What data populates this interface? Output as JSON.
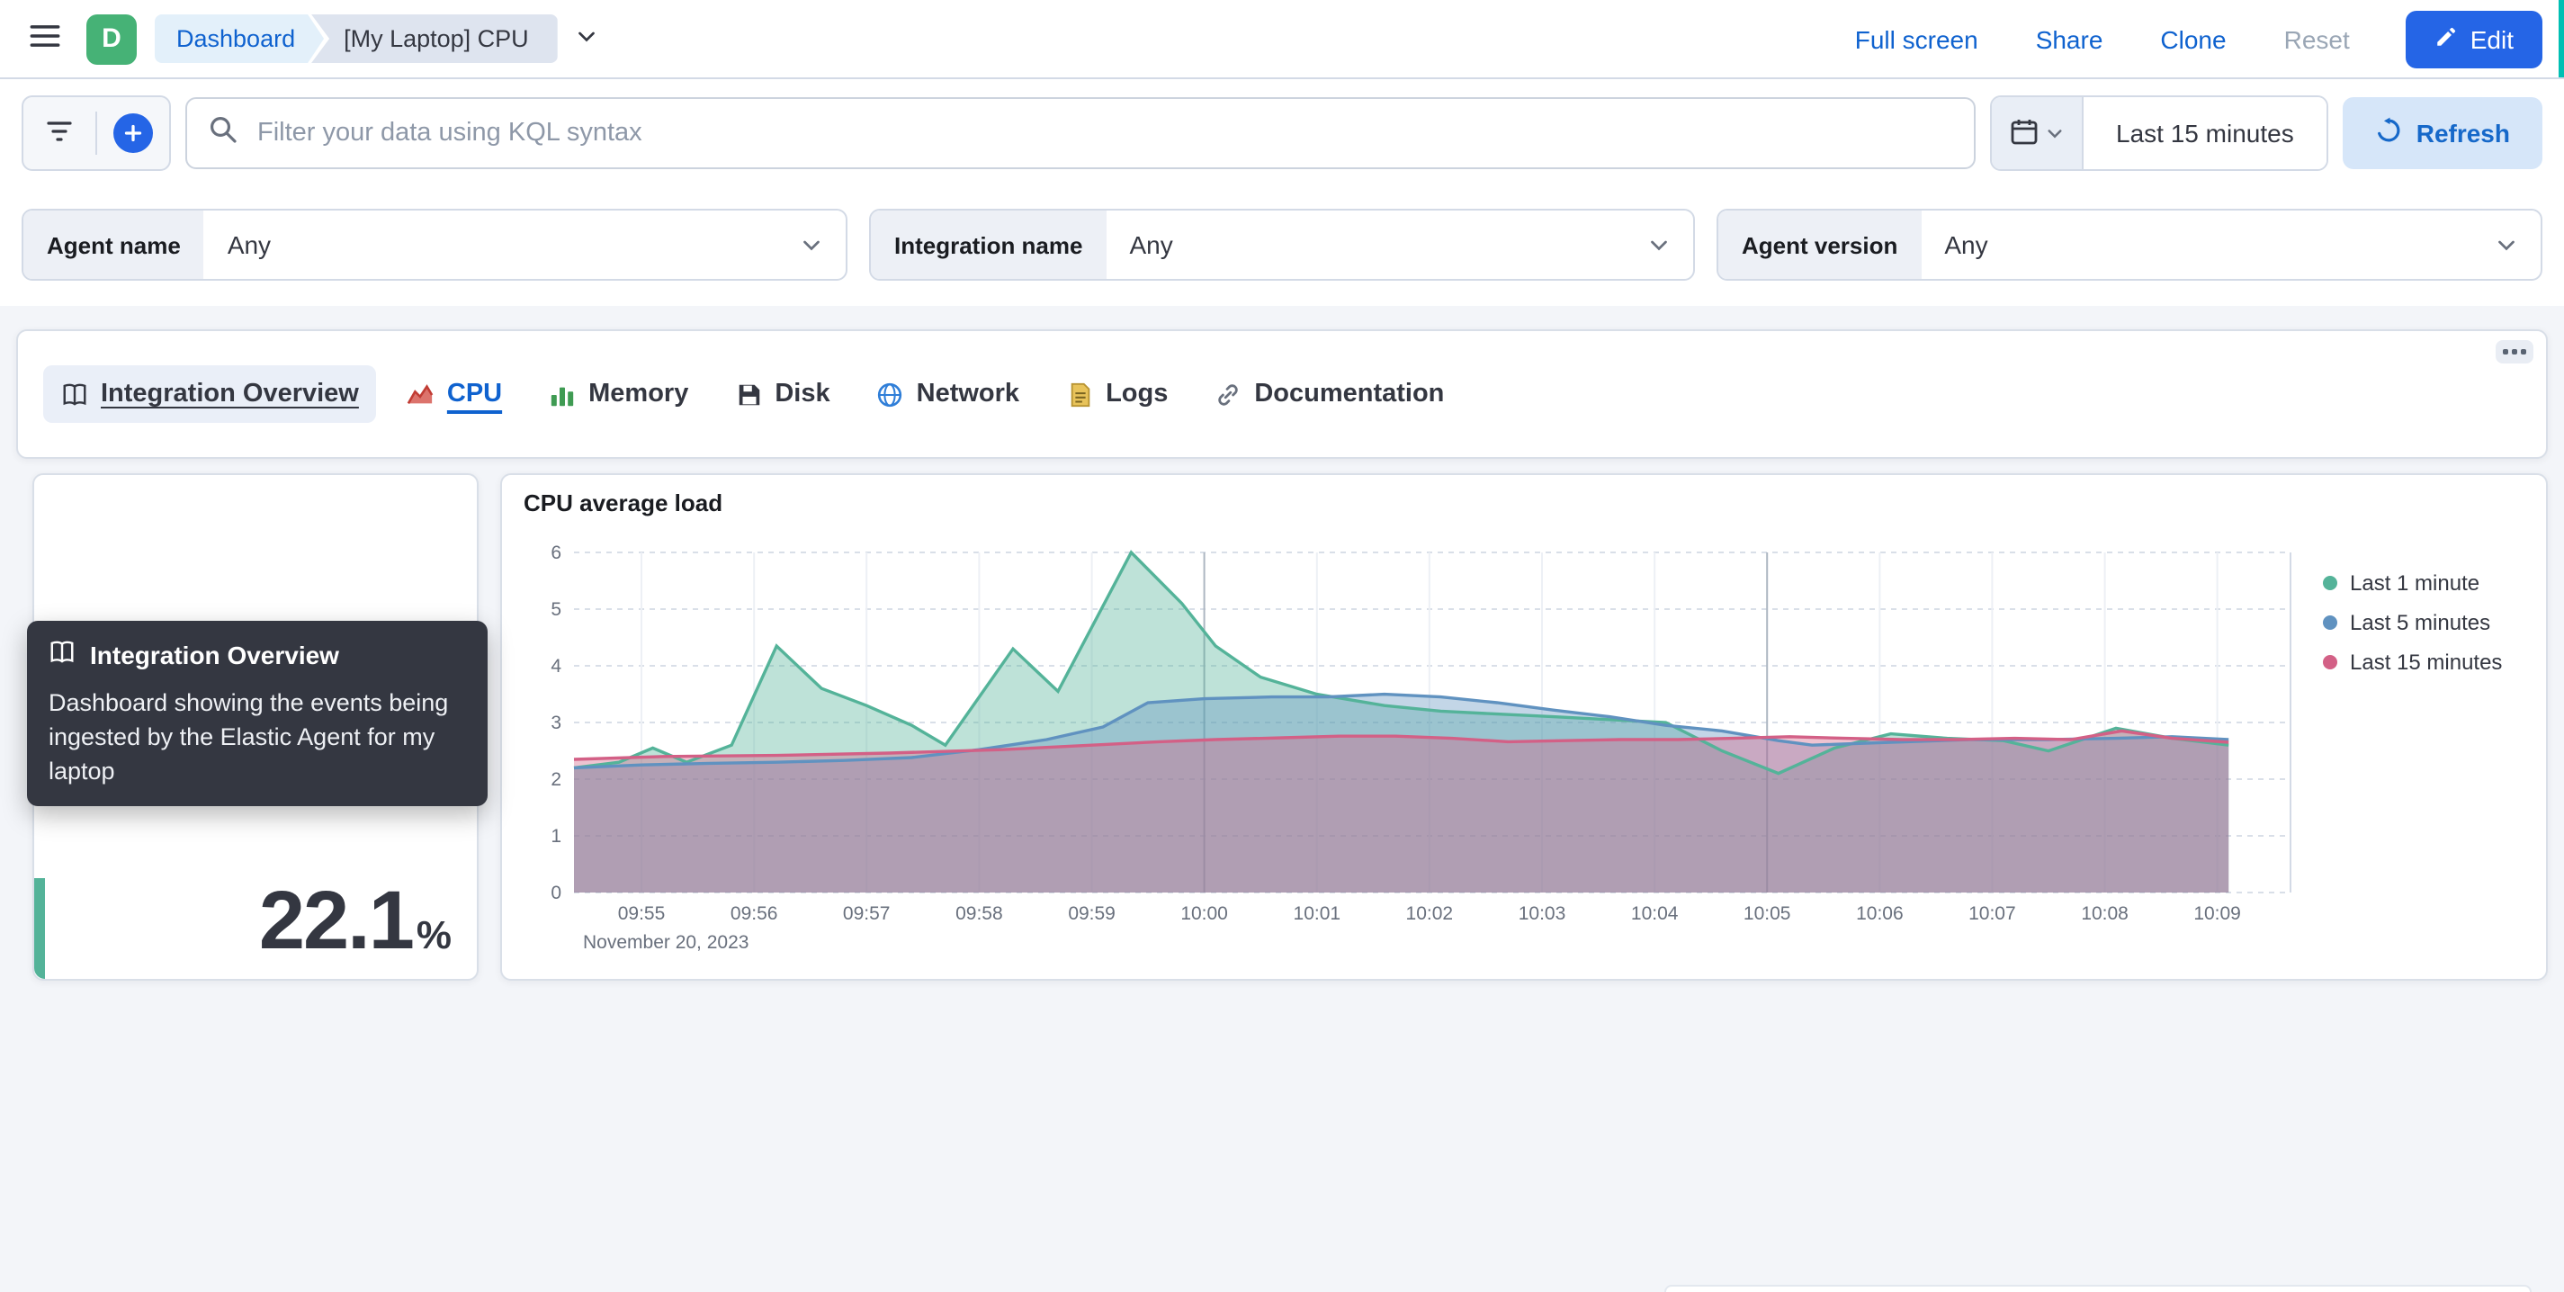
{
  "colors": {
    "primary_button": "#2565e6",
    "link": "#0f62cf",
    "logo_green": "#46b276",
    "metric_accent": "#54B399",
    "series_green": "#54B399",
    "series_blue": "#6092C0",
    "series_pink": "#D36086"
  },
  "header": {
    "logo_letter": "D",
    "breadcrumbs": [
      {
        "label": "Dashboard"
      },
      {
        "label": "[My Laptop] CPU"
      }
    ],
    "actions": [
      {
        "label": "Full screen",
        "enabled": true
      },
      {
        "label": "Share",
        "enabled": true
      },
      {
        "label": "Clone",
        "enabled": true
      },
      {
        "label": "Reset",
        "enabled": false
      }
    ],
    "edit_label": "Edit"
  },
  "query_bar": {
    "search_placeholder": "Filter your data using KQL syntax",
    "time_range": "Last 15 minutes",
    "refresh_label": "Refresh"
  },
  "filters": [
    {
      "label": "Agent name",
      "value": "Any"
    },
    {
      "label": "Integration name",
      "value": "Any"
    },
    {
      "label": "Agent version",
      "value": "Any"
    }
  ],
  "nav_tabs": [
    {
      "label": "Integration Overview",
      "icon": "book-icon",
      "state": "hover"
    },
    {
      "label": "CPU",
      "icon": "line-chart-icon",
      "state": "selected"
    },
    {
      "label": "Memory",
      "icon": "bar-chart-icon",
      "state": "default"
    },
    {
      "label": "Disk",
      "icon": "disk-icon",
      "state": "default"
    },
    {
      "label": "Network",
      "icon": "network-icon",
      "state": "default"
    },
    {
      "label": "Logs",
      "icon": "logs-icon",
      "state": "default"
    },
    {
      "label": "Documentation",
      "icon": "link-icon",
      "state": "default"
    }
  ],
  "tooltip": {
    "title": "Integration Overview",
    "body": "Dashboard showing the events being ingested by the Elastic Agent for my laptop"
  },
  "metric_panel": {
    "value": "22.1",
    "unit": "%"
  },
  "chart_panel": {
    "title": "CPU average load"
  },
  "chart_data": {
    "type": "area",
    "title": "CPU average load",
    "xlabel": "",
    "ylabel": "",
    "ylim": [
      0,
      6
    ],
    "y_ticks": [
      0,
      1,
      2,
      3,
      4,
      5,
      6
    ],
    "x_ticks": [
      "09:55",
      "09:56",
      "09:57",
      "09:58",
      "09:59",
      "10:00",
      "10:01",
      "10:02",
      "10:03",
      "10:04",
      "10:05",
      "10:06",
      "10:07",
      "10:08",
      "10:09"
    ],
    "major_x_ticks": [
      "10:00",
      "10:05"
    ],
    "x_axis_date": "November 20, 2023",
    "x_unit_hint": "minutes after 09:54",
    "x_range": [
      0.4,
      15.65
    ],
    "grid": true,
    "legend_position": "right",
    "series": [
      {
        "name": "Last 1 minute",
        "color": "#54B399",
        "points": [
          [
            0.4,
            2.2
          ],
          [
            0.8,
            2.3
          ],
          [
            1.1,
            2.55
          ],
          [
            1.4,
            2.3
          ],
          [
            1.8,
            2.6
          ],
          [
            2.2,
            4.35
          ],
          [
            2.6,
            3.6
          ],
          [
            3.0,
            3.3
          ],
          [
            3.4,
            2.95
          ],
          [
            3.7,
            2.6
          ],
          [
            4.3,
            4.3
          ],
          [
            4.7,
            3.55
          ],
          [
            5.35,
            6.0
          ],
          [
            5.8,
            5.1
          ],
          [
            6.1,
            4.35
          ],
          [
            6.5,
            3.8
          ],
          [
            7.0,
            3.5
          ],
          [
            7.6,
            3.3
          ],
          [
            8.1,
            3.2
          ],
          [
            8.6,
            3.15
          ],
          [
            9.1,
            3.1
          ],
          [
            9.6,
            3.05
          ],
          [
            10.1,
            3.0
          ],
          [
            10.6,
            2.5
          ],
          [
            11.1,
            2.1
          ],
          [
            11.6,
            2.55
          ],
          [
            12.1,
            2.8
          ],
          [
            12.6,
            2.72
          ],
          [
            13.1,
            2.68
          ],
          [
            13.5,
            2.5
          ],
          [
            14.1,
            2.9
          ],
          [
            14.6,
            2.72
          ],
          [
            15.1,
            2.6
          ]
        ]
      },
      {
        "name": "Last 5 minutes",
        "color": "#6092C0",
        "points": [
          [
            0.4,
            2.2
          ],
          [
            1.0,
            2.25
          ],
          [
            1.6,
            2.28
          ],
          [
            2.2,
            2.3
          ],
          [
            2.8,
            2.33
          ],
          [
            3.4,
            2.38
          ],
          [
            4.0,
            2.52
          ],
          [
            4.6,
            2.7
          ],
          [
            5.1,
            2.92
          ],
          [
            5.5,
            3.35
          ],
          [
            6.0,
            3.42
          ],
          [
            6.6,
            3.45
          ],
          [
            7.1,
            3.45
          ],
          [
            7.6,
            3.5
          ],
          [
            8.1,
            3.45
          ],
          [
            8.6,
            3.35
          ],
          [
            9.1,
            3.22
          ],
          [
            9.6,
            3.1
          ],
          [
            10.1,
            2.95
          ],
          [
            10.6,
            2.85
          ],
          [
            11.1,
            2.68
          ],
          [
            11.4,
            2.6
          ],
          [
            12.1,
            2.65
          ],
          [
            12.8,
            2.7
          ],
          [
            13.5,
            2.7
          ],
          [
            14.1,
            2.72
          ],
          [
            14.6,
            2.75
          ],
          [
            15.1,
            2.7
          ]
        ]
      },
      {
        "name": "Last 15 minutes",
        "color": "#D36086",
        "points": [
          [
            0.4,
            2.35
          ],
          [
            1.2,
            2.4
          ],
          [
            2.2,
            2.42
          ],
          [
            3.2,
            2.46
          ],
          [
            4.2,
            2.52
          ],
          [
            5.0,
            2.6
          ],
          [
            5.6,
            2.66
          ],
          [
            6.1,
            2.7
          ],
          [
            6.7,
            2.73
          ],
          [
            7.2,
            2.76
          ],
          [
            7.7,
            2.76
          ],
          [
            8.2,
            2.72
          ],
          [
            8.7,
            2.66
          ],
          [
            9.2,
            2.68
          ],
          [
            9.7,
            2.7
          ],
          [
            10.2,
            2.7
          ],
          [
            10.7,
            2.72
          ],
          [
            11.2,
            2.75
          ],
          [
            11.7,
            2.72
          ],
          [
            12.2,
            2.7
          ],
          [
            12.7,
            2.7
          ],
          [
            13.2,
            2.72
          ],
          [
            13.7,
            2.7
          ],
          [
            14.15,
            2.85
          ],
          [
            14.6,
            2.72
          ],
          [
            15.1,
            2.65
          ]
        ]
      }
    ]
  }
}
